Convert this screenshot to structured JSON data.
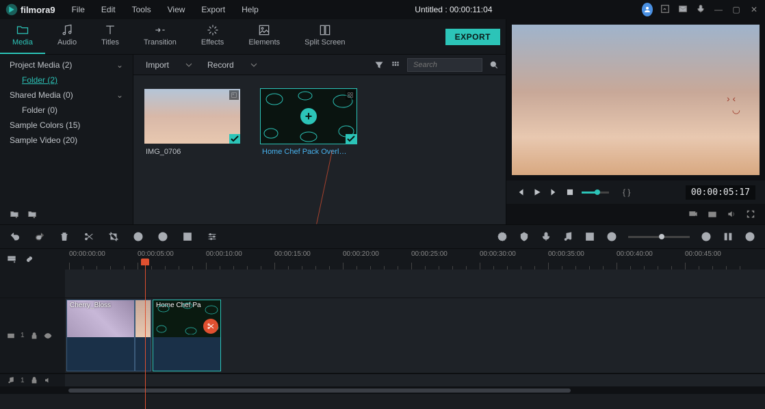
{
  "app": {
    "name": "filmora9",
    "title": "Untitled : 00:00:11:04"
  },
  "menu": {
    "file": "File",
    "edit": "Edit",
    "tools": "Tools",
    "view": "View",
    "export": "Export",
    "help": "Help"
  },
  "tabs": {
    "media": "Media",
    "audio": "Audio",
    "titles": "Titles",
    "transition": "Transition",
    "effects": "Effects",
    "elements": "Elements",
    "split": "Split Screen"
  },
  "export_btn": "EXPORT",
  "sidebar": {
    "project_media": "Project Media (2)",
    "folder": "Folder (2)",
    "shared_media": "Shared Media (0)",
    "folder0": "Folder (0)",
    "sample_colors": "Sample Colors (15)",
    "sample_video": "Sample Video (20)"
  },
  "content_toolbar": {
    "import": "Import",
    "record": "Record",
    "search_placeholder": "Search"
  },
  "thumbs": {
    "img0706": "IMG_0706",
    "homechef": "Home Chef Pack Overl…"
  },
  "preview": {
    "timecode": "00:00:05:17",
    "markers": "{  }"
  },
  "ruler": [
    "00:00:00:00",
    "00:00:05:00",
    "00:00:10:00",
    "00:00:15:00",
    "00:00:20:00",
    "00:00:25:00",
    "00:00:30:00",
    "00:00:35:00",
    "00:00:40:00",
    "00:00:45:00"
  ],
  "clips": {
    "cherry": "Cherry_Bloss",
    "homechef": "Home Chef Pa"
  },
  "track": {
    "video1": "1",
    "audio1": "1"
  }
}
